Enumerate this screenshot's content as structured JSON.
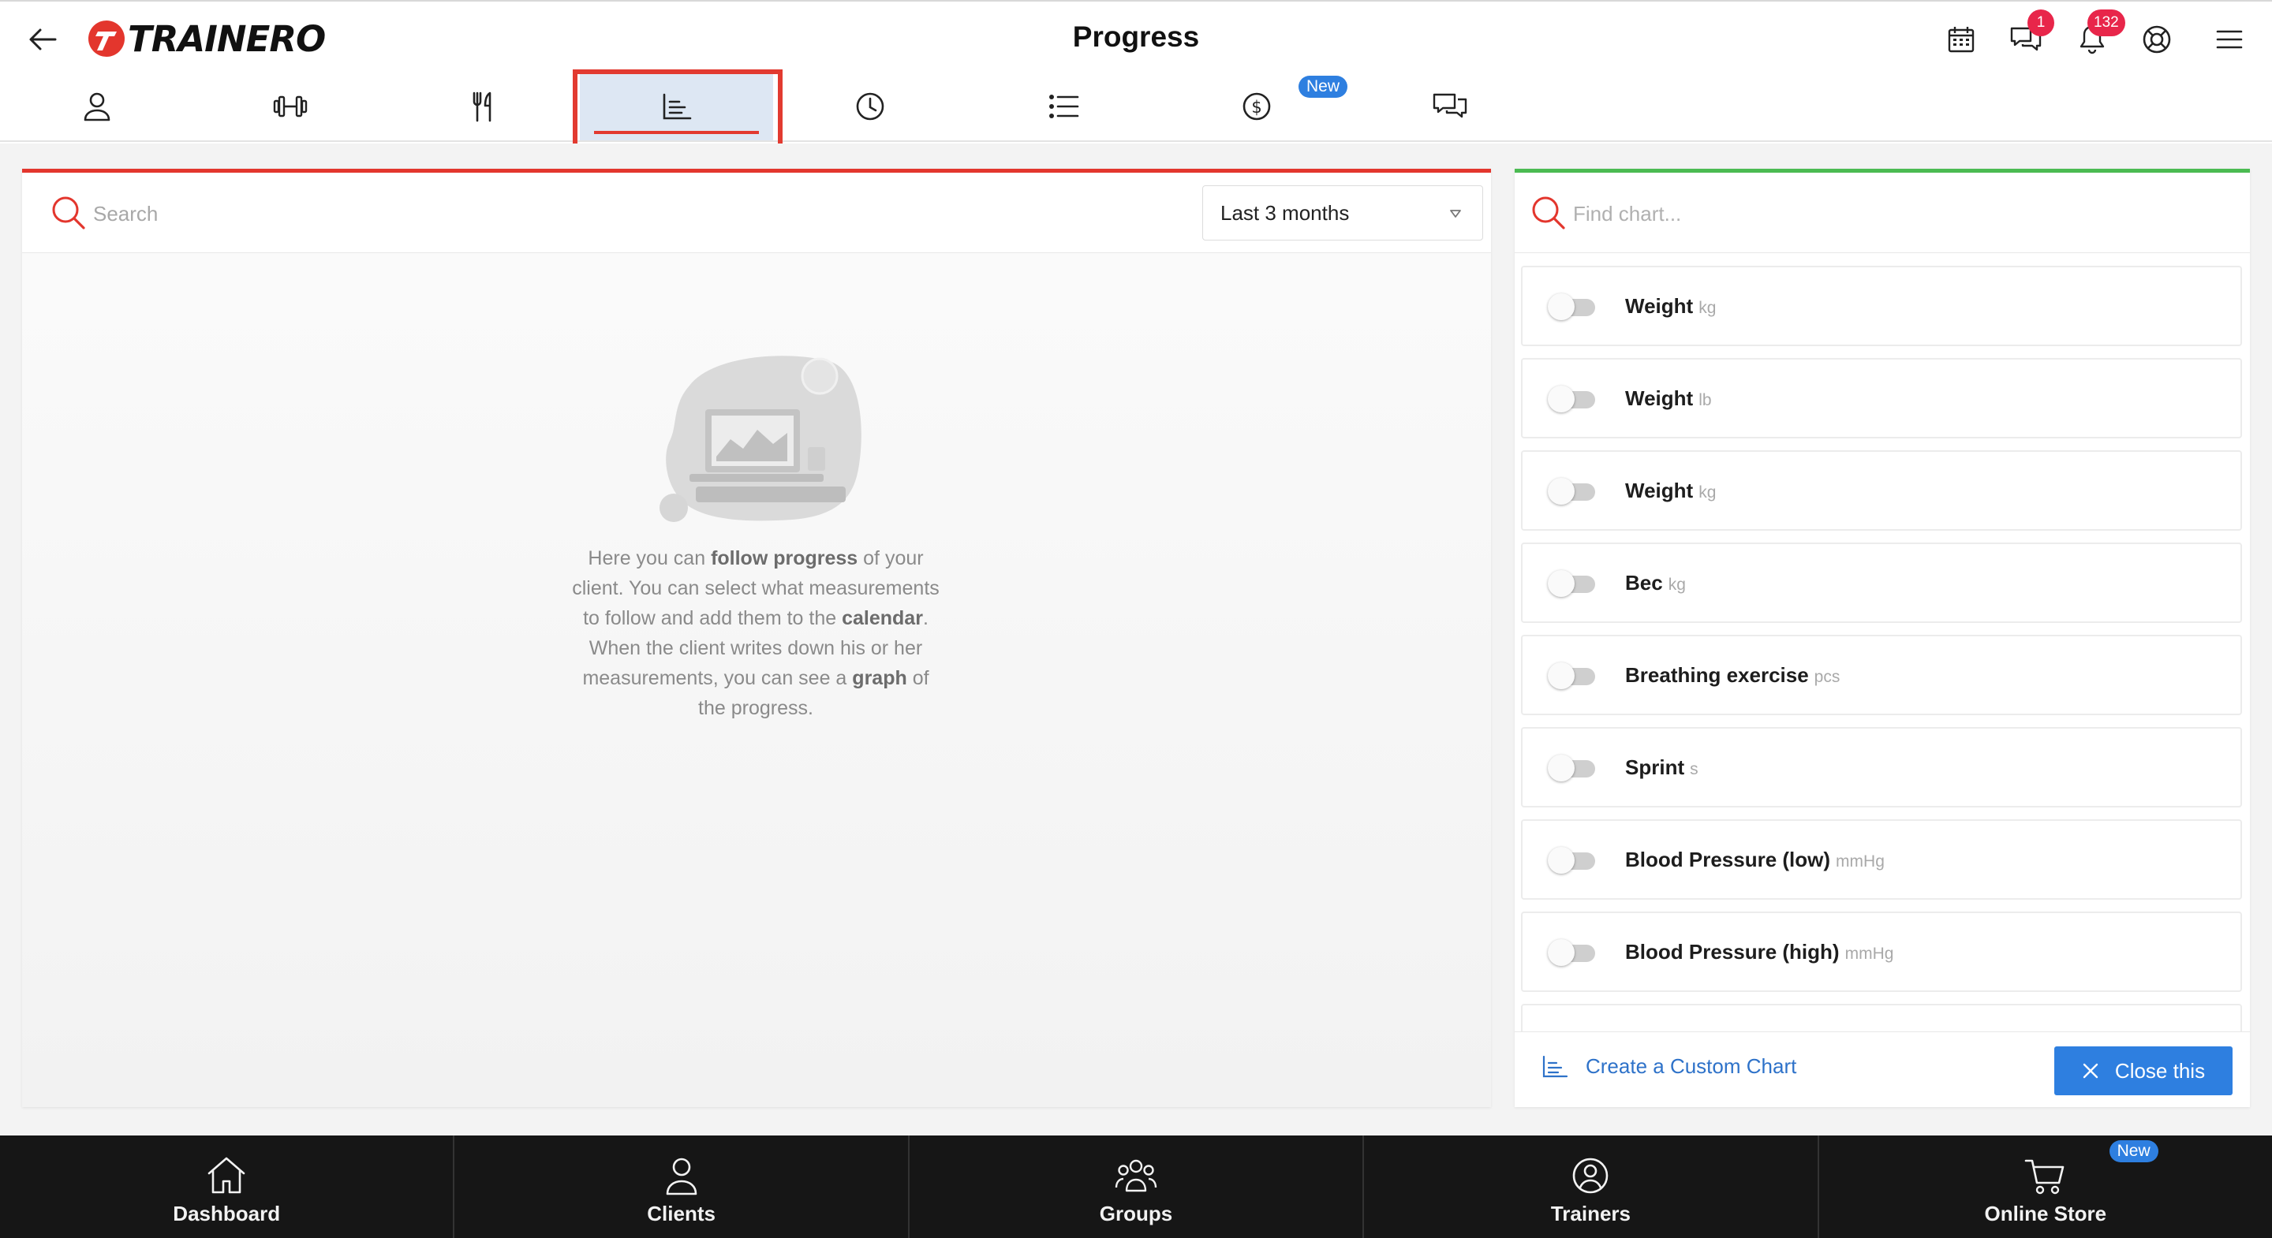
{
  "header": {
    "title": "Progress",
    "logo_text": "TRAINERO",
    "messages_badge": "1",
    "notifications_badge": "132"
  },
  "tabs": [
    {
      "icon": "person-icon"
    },
    {
      "icon": "dumbbell-icon"
    },
    {
      "icon": "cutlery-icon"
    },
    {
      "icon": "chart-icon",
      "active": true
    },
    {
      "icon": "clock-icon"
    },
    {
      "icon": "list-icon"
    },
    {
      "icon": "dollar-icon",
      "badge": "New"
    },
    {
      "icon": "chat-icon"
    }
  ],
  "progress": {
    "search_placeholder": "Search",
    "range_value": "Last 3 months",
    "empty_text": {
      "p1": "Here you can ",
      "b1": "follow progress",
      "p2": " of your client. You can select what measurements to follow and add them to the ",
      "b2": "calendar",
      "p3": ". When the client writes down his or her measurements, you can see a ",
      "b3": "graph",
      "p4": " of the progress."
    }
  },
  "chart_picker": {
    "search_placeholder": "Find chart...",
    "items": [
      {
        "name": "Weight",
        "unit": "kg",
        "enabled": false
      },
      {
        "name": "Weight",
        "unit": "lb",
        "enabled": false
      },
      {
        "name": "Weight",
        "unit": "kg",
        "enabled": false
      },
      {
        "name": "Bec",
        "unit": "kg",
        "enabled": false
      },
      {
        "name": "Breathing exercise",
        "unit": "pcs",
        "enabled": false
      },
      {
        "name": "Sprint",
        "unit": "s",
        "enabled": false
      },
      {
        "name": "Blood Pressure (low)",
        "unit": "mmHg",
        "enabled": false
      },
      {
        "name": "Blood Pressure (high)",
        "unit": "mmHg",
        "enabled": false
      }
    ],
    "create_label": "Create a Custom Chart",
    "close_label": "Close this"
  },
  "bottom_nav": {
    "dashboard": "Dashboard",
    "clients": "Clients",
    "groups": "Groups",
    "trainers": "Trainers",
    "store": "Online Store",
    "store_badge": "New"
  },
  "colors": {
    "accent_red": "#e3362d",
    "accent_green": "#4bbb52",
    "link_blue": "#2e72c9",
    "button_blue": "#2e7fe0",
    "badge_red": "#e8264a",
    "nav_bg": "#161616"
  }
}
